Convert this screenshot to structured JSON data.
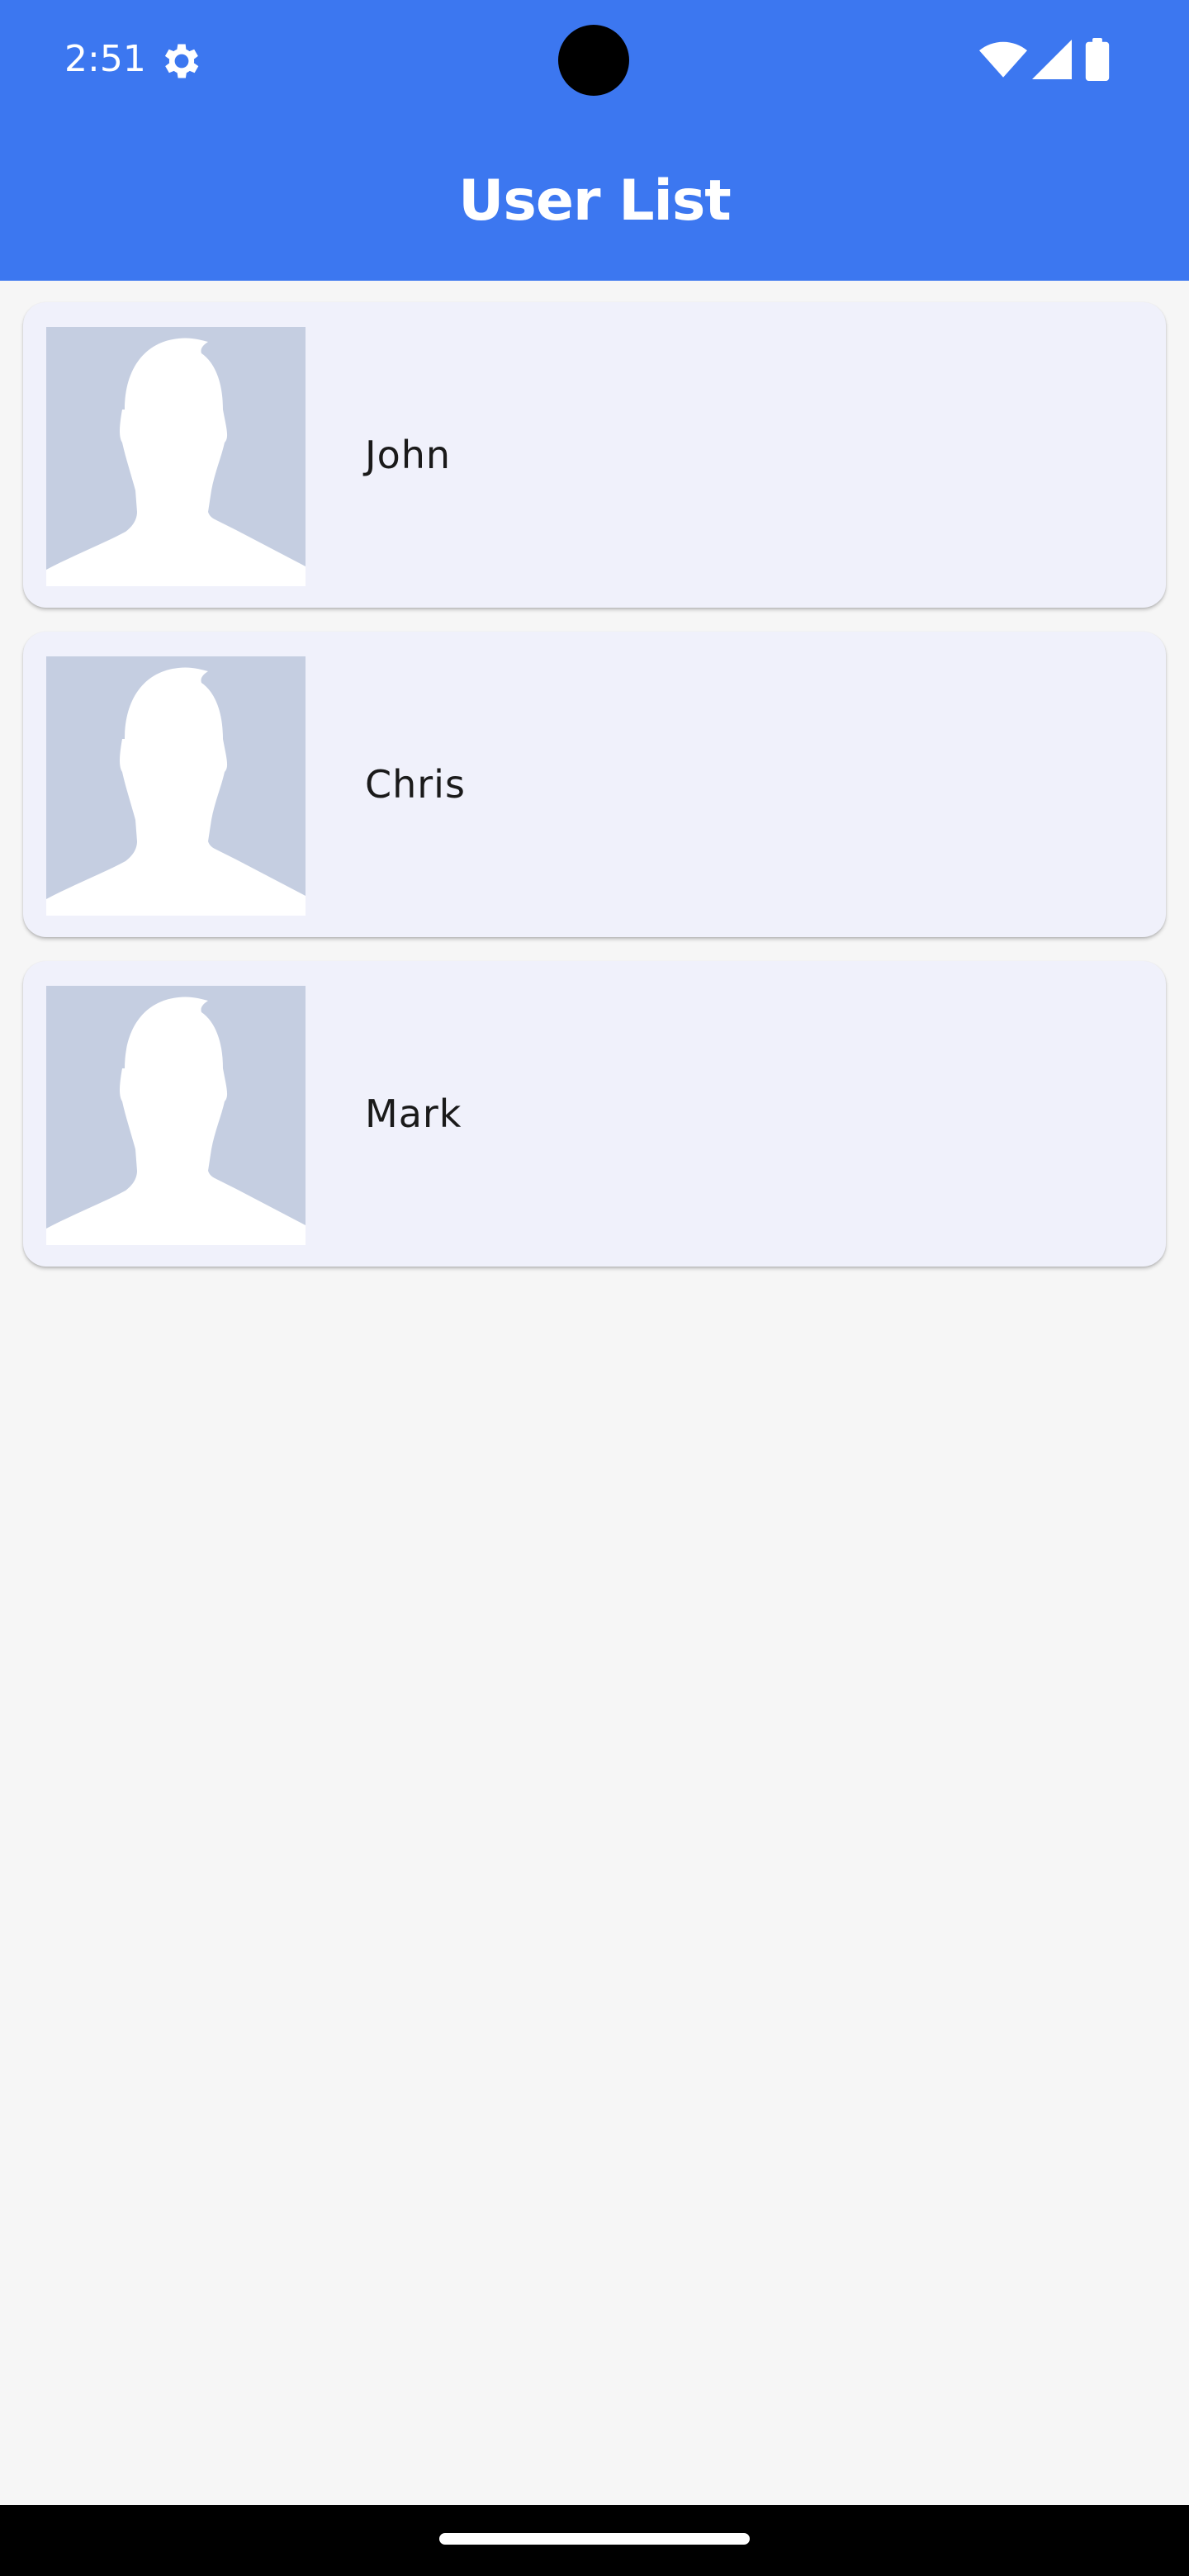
{
  "status_bar": {
    "time": "2:51",
    "icons": [
      "gear-icon",
      "wifi-icon",
      "signal-icon",
      "battery-icon"
    ]
  },
  "app_bar": {
    "title": "User List",
    "color": "#3c77f0"
  },
  "users": [
    {
      "name": "John",
      "avatar": "default-avatar-icon"
    },
    {
      "name": "Chris",
      "avatar": "default-avatar-icon"
    },
    {
      "name": "Mark",
      "avatar": "default-avatar-icon"
    }
  ],
  "colors": {
    "card_background": "#f0f1fb",
    "avatar_background": "#c5cee1",
    "page_background": "#f6f6f6"
  }
}
